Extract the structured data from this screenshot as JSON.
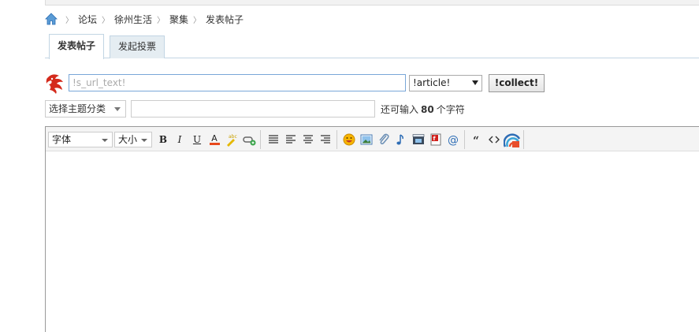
{
  "breadcrumb": {
    "items": [
      "论坛",
      "徐州生活",
      "聚集",
      "发表帖子"
    ]
  },
  "tabs": {
    "post": "发表帖子",
    "poll": "发起投票"
  },
  "url_row": {
    "placeholder": "!s_url_text!",
    "article_option": "!article!",
    "collect_label": "!collect!"
  },
  "subject_row": {
    "type_select": "选择主题分类",
    "counter_prefix": "还可输入",
    "counter_value": "80",
    "counter_suffix": "个字符"
  },
  "toolbar": {
    "font_label": "字体",
    "size_label": "大小",
    "bold": "B",
    "italic": "I",
    "underline": "U",
    "color": "A"
  },
  "colors": {
    "tab_border": "#c2d5e3",
    "tab_inactive_bg": "#e5edf2",
    "input_focus_border": "#7aa7d8"
  }
}
